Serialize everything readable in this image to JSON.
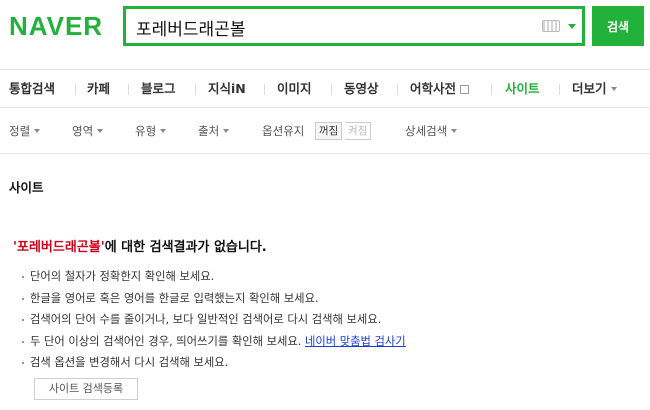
{
  "header": {
    "logo": "NAVER",
    "search_value": "포레버드래곤볼",
    "search_button": "검색"
  },
  "colors": {
    "brand_green": "#22b13b",
    "query_red": "#d0021b",
    "link_blue": "#1a3dd1"
  },
  "icons": [
    "keyboard-icon",
    "chevron-down-icon",
    "box-icon"
  ],
  "nav": {
    "items": [
      "통합검색",
      "카페",
      "블로그",
      "지식iN",
      "이미지",
      "동영상",
      "어학사전",
      "사이트",
      "더보기"
    ],
    "active": "사이트"
  },
  "filters": {
    "items": [
      "정렬",
      "영역",
      "유형",
      "출처",
      "옵션유지",
      "상세검색"
    ],
    "toggle_on": "꺼짐",
    "toggle_off": "켜짐"
  },
  "section": {
    "title": "사이트"
  },
  "result": {
    "query": "'포레버드래곤볼'",
    "message": "에 대한 검색결과가 없습니다."
  },
  "tips": [
    "단어의 철자가 정확한지 확인해 보세요.",
    "한글을 영어로 혹은 영어를 한글로 입력했는지 확인해 보세요.",
    "검색어의 단어 수를 줄이거나, 보다 일반적인 검색어로 다시 검색해 보세요.",
    "두 단어 이상의 검색어인 경우, 띄어쓰기를 확인해 보세요.",
    "검색 옵션을 변경해서 다시 검색해 보세요."
  ],
  "spell_link": "네이버 맞춤법 검사기",
  "register_button": "사이트 검색등록"
}
